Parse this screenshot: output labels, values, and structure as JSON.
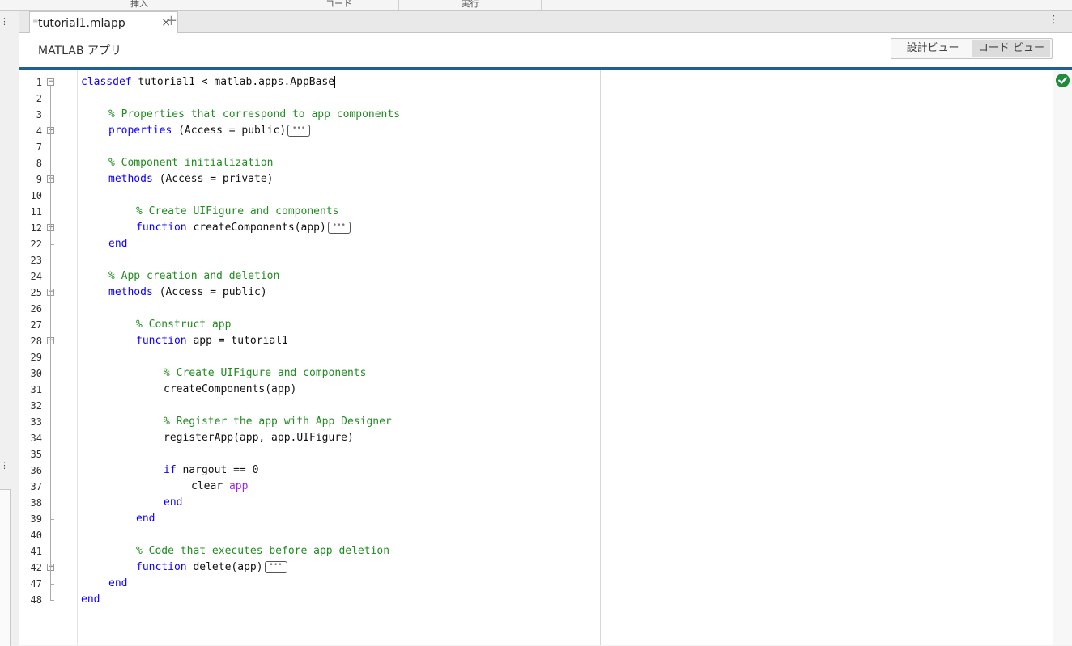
{
  "toolstrip": {
    "sections": [
      "挿入",
      "コード",
      "実行"
    ]
  },
  "tab": {
    "label": "tutorial1.mlapp",
    "close_icon": "×",
    "add_icon": "+",
    "menu_icon": "⋮",
    "grip_icon": "≡"
  },
  "app_header": {
    "title": "MATLAB アプリ",
    "design_view": "設計ビュー",
    "code_view": "コード ビュー"
  },
  "status": {
    "icon": "check-circle-icon",
    "color": "#1e8c3a"
  },
  "code_lines": [
    {
      "num": "1",
      "indent": 0,
      "tokens": [
        {
          "t": "classdef",
          "c": "kw"
        },
        {
          "t": " tutorial1 < matlab.apps.AppBase",
          "c": ""
        }
      ],
      "fold": "minus",
      "caret": true
    },
    {
      "num": "2",
      "indent": 0,
      "tokens": []
    },
    {
      "num": "3",
      "indent": 1,
      "tokens": [
        {
          "t": "% Properties that correspond to app components",
          "c": "cm"
        }
      ]
    },
    {
      "num": "4",
      "indent": 1,
      "tokens": [
        {
          "t": "properties",
          "c": "kw"
        },
        {
          "t": " (Access = public)",
          "c": ""
        }
      ],
      "fold": "plus",
      "ellipsis": true
    },
    {
      "num": "7",
      "indent": 0,
      "tokens": []
    },
    {
      "num": "8",
      "indent": 1,
      "tokens": [
        {
          "t": "% Component initialization",
          "c": "cm"
        }
      ]
    },
    {
      "num": "9",
      "indent": 1,
      "tokens": [
        {
          "t": "methods",
          "c": "kw"
        },
        {
          "t": " (Access = private)",
          "c": ""
        }
      ],
      "fold": "minus"
    },
    {
      "num": "10",
      "indent": 0,
      "tokens": []
    },
    {
      "num": "11",
      "indent": 2,
      "tokens": [
        {
          "t": "% Create UIFigure and components",
          "c": "cm"
        }
      ]
    },
    {
      "num": "12",
      "indent": 2,
      "tokens": [
        {
          "t": "function",
          "c": "kw"
        },
        {
          "t": " createComponents(app)",
          "c": ""
        }
      ],
      "fold": "plus",
      "ellipsis": true
    },
    {
      "num": "22",
      "indent": 1,
      "tokens": [
        {
          "t": "end",
          "c": "kw"
        }
      ],
      "fold": "end"
    },
    {
      "num": "23",
      "indent": 0,
      "tokens": []
    },
    {
      "num": "24",
      "indent": 1,
      "tokens": [
        {
          "t": "% App creation and deletion",
          "c": "cm"
        }
      ]
    },
    {
      "num": "25",
      "indent": 1,
      "tokens": [
        {
          "t": "methods",
          "c": "kw"
        },
        {
          "t": " (Access = public)",
          "c": ""
        }
      ],
      "fold": "minus"
    },
    {
      "num": "26",
      "indent": 0,
      "tokens": []
    },
    {
      "num": "27",
      "indent": 2,
      "tokens": [
        {
          "t": "% Construct app",
          "c": "cm"
        }
      ]
    },
    {
      "num": "28",
      "indent": 2,
      "tokens": [
        {
          "t": "function",
          "c": "kw"
        },
        {
          "t": " app = tutorial1",
          "c": ""
        }
      ],
      "fold": "minus"
    },
    {
      "num": "29",
      "indent": 0,
      "tokens": []
    },
    {
      "num": "30",
      "indent": 3,
      "tokens": [
        {
          "t": "% Create UIFigure and components",
          "c": "cm"
        }
      ]
    },
    {
      "num": "31",
      "indent": 3,
      "tokens": [
        {
          "t": "createComponents(app)",
          "c": ""
        }
      ]
    },
    {
      "num": "32",
      "indent": 0,
      "tokens": []
    },
    {
      "num": "33",
      "indent": 3,
      "tokens": [
        {
          "t": "% Register the app with App Designer",
          "c": "cm"
        }
      ]
    },
    {
      "num": "34",
      "indent": 3,
      "tokens": [
        {
          "t": "registerApp(app, app.UIFigure)",
          "c": ""
        }
      ]
    },
    {
      "num": "35",
      "indent": 0,
      "tokens": []
    },
    {
      "num": "36",
      "indent": 3,
      "tokens": [
        {
          "t": "if",
          "c": "kw"
        },
        {
          "t": " nargout == 0",
          "c": ""
        }
      ]
    },
    {
      "num": "37",
      "indent": 4,
      "tokens": [
        {
          "t": "clear ",
          "c": ""
        },
        {
          "t": "app",
          "c": "pu"
        }
      ]
    },
    {
      "num": "38",
      "indent": 3,
      "tokens": [
        {
          "t": "end",
          "c": "kw"
        }
      ]
    },
    {
      "num": "39",
      "indent": 2,
      "tokens": [
        {
          "t": "end",
          "c": "kw"
        }
      ],
      "fold": "end"
    },
    {
      "num": "40",
      "indent": 0,
      "tokens": []
    },
    {
      "num": "41",
      "indent": 2,
      "tokens": [
        {
          "t": "% Code that executes before app deletion",
          "c": "cm"
        }
      ]
    },
    {
      "num": "42",
      "indent": 2,
      "tokens": [
        {
          "t": "function",
          "c": "kw"
        },
        {
          "t": " delete(app)",
          "c": ""
        }
      ],
      "fold": "plus",
      "ellipsis": true
    },
    {
      "num": "47",
      "indent": 1,
      "tokens": [
        {
          "t": "end",
          "c": "kw"
        }
      ],
      "fold": "end"
    },
    {
      "num": "48",
      "indent": 0,
      "tokens": [
        {
          "t": "end",
          "c": "kw"
        }
      ],
      "fold": "end"
    }
  ]
}
